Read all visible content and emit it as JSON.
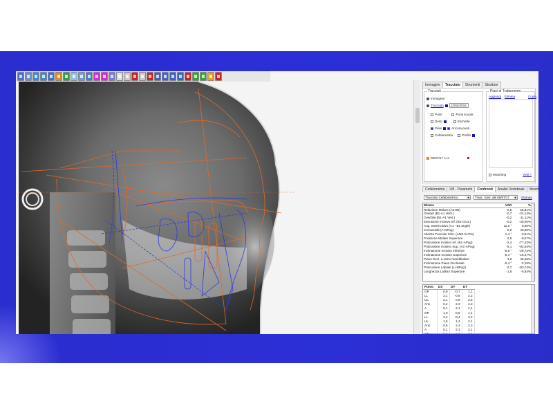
{
  "toolbar": {
    "buttons": [
      {
        "icon": "select-icon",
        "color": "#4a6fd0"
      },
      {
        "icon": "hand-icon",
        "color": "#6a8fd8"
      },
      {
        "icon": "rotate-left-icon",
        "color": "#3d88d6"
      },
      {
        "icon": "rotate-right-icon",
        "color": "#3d88d6"
      },
      {
        "icon": "flip-icon",
        "color": "#3d6fd0"
      },
      {
        "icon": "zoom-icon",
        "color": "#e08a1a"
      },
      {
        "icon": "contrast-icon",
        "color": "#2f9f4a"
      },
      {
        "icon": "brightness-icon",
        "color": "#8ac4e8"
      },
      {
        "icon": "crop-icon",
        "color": "#6a9fd8"
      },
      {
        "icon": "calibrate-icon",
        "color": "#3f7fd0"
      },
      {
        "icon": "ruler-icon",
        "color": "#d82ad0"
      },
      {
        "icon": "angle-icon",
        "color": "#d82ad0"
      },
      {
        "icon": "text-icon",
        "color": "#7a7ae0"
      },
      {
        "icon": "pen-icon",
        "color": "#dcdcdc"
      },
      {
        "icon": "cut-icon",
        "color": "#c8c8c8"
      },
      {
        "icon": "color-icon",
        "color": "#d02020"
      },
      {
        "icon": "point-icon",
        "color": "#c8c8c8"
      },
      {
        "icon": "record-icon",
        "color": "#d02020"
      },
      {
        "icon": "print-icon",
        "color": "#3a62c8"
      },
      {
        "icon": "save-icon",
        "color": "#3a62c8"
      },
      {
        "icon": "export-icon",
        "color": "#3a62c8"
      },
      {
        "icon": "share-icon",
        "color": "#3a62c8"
      },
      {
        "icon": "pdf-icon",
        "color": "#d02020"
      },
      {
        "icon": "check-icon",
        "color": "#2aaa2a"
      },
      {
        "icon": "confirm-icon",
        "color": "#2aaa2a"
      },
      {
        "icon": "undo-icon",
        "color": "#e0a020"
      },
      {
        "icon": "close-icon",
        "color": "#d02020"
      }
    ]
  },
  "top_tabs": [
    "Immagine",
    "Tracciato",
    "Strumenti",
    "Strutture"
  ],
  "top_active": 1,
  "tracciati": {
    "legend": "Tracciati",
    "immagine": "Immagine",
    "tracciato_link": "Tracciato",
    "tracciato_date": "12/02/2018",
    "punti": "Punti",
    "punti_scuola": "Punti scuola",
    "denti": "Denti",
    "etichette": "Etichette",
    "piani": "Piani",
    "ancora_punti": "Ancora punti",
    "cefalometria": "Cefalometria",
    "profilo": "Profilo",
    "session_item": "06/07/17 e+a"
  },
  "piani_trattamento": {
    "legend": "Piani di Trattamento",
    "aggiungi": "Aggiungi",
    "elimina": "Elimina",
    "copia": "Copia",
    "morphing": "Morphing",
    "vedi": "Vedi >"
  },
  "mid_tabs": [
    "Cefalometria",
    "LM - Parametri",
    "Confronti",
    "Analisi Vertebrale",
    "Movimenti"
  ],
  "mid_active": 2,
  "filters": {
    "tracciato": "Tracciato Cefalometrico",
    "compare": "Trasc. Sovr. del 06/07/17",
    "stampa": "Stampa"
  },
  "measures": {
    "headers": [
      "Misura",
      "VAR",
      "%"
    ],
    "rows": [
      [
        "Relazione Molare (A6-B6)",
        "-0,5",
        "25,81%"
      ],
      [
        "Overjet (B1-A1 Horz.)",
        "-0,7",
        "-24,14%"
      ],
      [
        "Overbite (B1-A1 Vert.)",
        "-0,2",
        "-11,11%"
      ],
      [
        "Estrusione Incisivo Inf. (B1-OccL)",
        "-0,2",
        "-40,00%"
      ],
      [
        "Ang. Interincisivo (A1 - B1 angle)",
        "11,0 °",
        "8,90%"
      ],
      [
        "Convessità (A-NPog)",
        "0,2",
        "40,00%"
      ],
      [
        "Altezza Facciale Infer. (ANS-Xi-Pm)",
        "-1,4 °",
        "-3,51%"
      ],
      [
        "Posizione Molare Superiore",
        "-2,5",
        "-8,57%"
      ],
      [
        "Protrusione Incisivo Inf. (B1-APog)",
        "-2,4",
        "-77,42%"
      ],
      [
        "Protrusione Incisivo Sup. (A1-APog)",
        "-5,1",
        "-92,54%"
      ],
      [
        "Inclinazione Incisivo Inferiore",
        "-5,6 °",
        "-29,74%"
      ],
      [
        "Inclinazione Incisivo Superiore",
        "-5,4 °",
        "-18,47%"
      ],
      [
        "Piano Occl. a ramo mandibolare",
        "3,6",
        "45,45%"
      ],
      [
        "Inclinazione Piano Occlusale",
        "-0,4 °",
        "-2,15%"
      ],
      [
        "Protrusione Labiale (Li-NPog')",
        "-2,7",
        "-83,74%"
      ],
      [
        "Lunghezza Labbro Superiore",
        "-1,5",
        "-5,84%"
      ]
    ]
  },
  "points": {
    "headers": [
      "Punto",
      "DX",
      "DY",
      "DT"
    ],
    "rows": [
      [
        "OP",
        "0,9",
        "-0,7",
        "1,1"
      ],
      [
        "LL",
        "2,1",
        "-0,8",
        "2,2"
      ],
      [
        "UL",
        "2,1",
        "0,9",
        "2,5"
      ],
      [
        "Ans",
        "0,2",
        "2,3",
        "2,3"
      ],
      [
        "A",
        "0,1",
        "2,1",
        "2,1"
      ],
      [
        "OP",
        "1,0",
        "-0,5",
        "1,1"
      ],
      [
        "LL",
        "2,2",
        "-0,4",
        "2,2"
      ],
      [
        "UL",
        "1,6",
        "1,3",
        "2,1"
      ],
      [
        "Ans",
        "0,6",
        "2,3",
        "2,3"
      ],
      [
        "A",
        "0,1",
        "2,1",
        "2,1"
      ],
      [
        "OP",
        "0,3",
        "2,2",
        "2,1"
      ],
      [
        "UL",
        "1,5",
        "0,8",
        "2,2"
      ],
      [
        "OP",
        "2,1",
        "-0,7",
        "2,2"
      ]
    ]
  },
  "colors": {
    "band": "#2b2fd6",
    "trace_orange": "#e06a2a",
    "trace_blue": "#2a3adc",
    "checkbox_blue": "#0a18b4"
  }
}
